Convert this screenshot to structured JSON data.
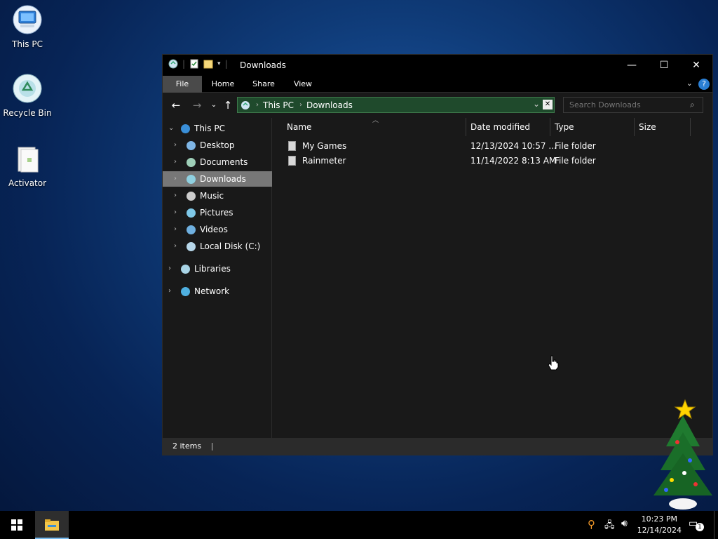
{
  "desktop": {
    "icons": [
      {
        "label": "This PC"
      },
      {
        "label": "Recycle Bin"
      },
      {
        "label": "Activator"
      }
    ]
  },
  "window": {
    "title": "Downloads",
    "controls": {
      "minimize": "—",
      "maximize": "☐",
      "close": "✕"
    },
    "ribbon_tabs": [
      "File",
      "Home",
      "Share",
      "View"
    ],
    "address": {
      "crumbs": [
        "This PC",
        "Downloads"
      ]
    },
    "search": {
      "placeholder": "Search Downloads"
    },
    "nav": {
      "items": [
        {
          "label": "This PC"
        },
        {
          "label": "Desktop"
        },
        {
          "label": "Documents"
        },
        {
          "label": "Downloads"
        },
        {
          "label": "Music"
        },
        {
          "label": "Pictures"
        },
        {
          "label": "Videos"
        },
        {
          "label": "Local Disk (C:)"
        },
        {
          "label": "Libraries"
        },
        {
          "label": "Network"
        }
      ]
    },
    "columns": [
      "Name",
      "Date modified",
      "Type",
      "Size"
    ],
    "files": [
      {
        "name": "My Games",
        "date": "12/13/2024 10:57 ...",
        "type": "File folder",
        "size": ""
      },
      {
        "name": "Rainmeter",
        "date": "11/14/2022 8:13 AM",
        "type": "File folder",
        "size": ""
      }
    ],
    "status": {
      "count": "2 items"
    }
  },
  "taskbar": {
    "time": "10:23 PM",
    "date": "12/14/2024",
    "notification_count": "1"
  },
  "colors": {
    "accent": "#1f4a2c",
    "selection": "#777777",
    "window_bg": "#191919"
  }
}
